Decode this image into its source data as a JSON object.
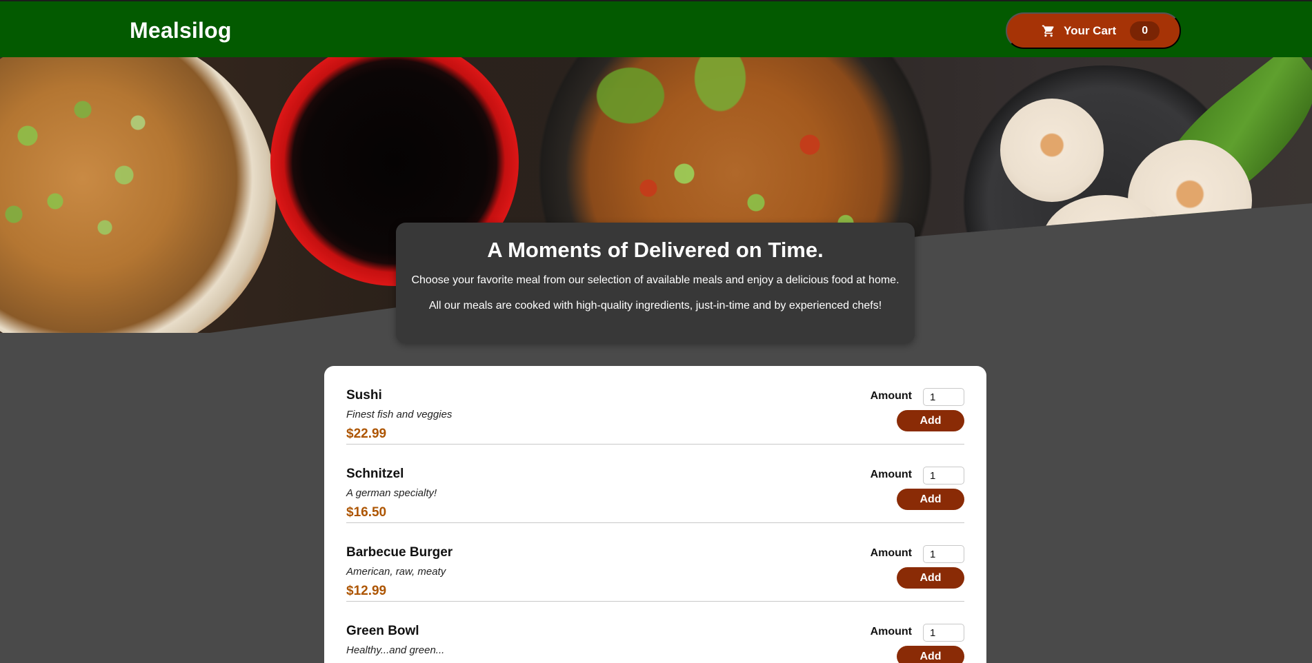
{
  "header": {
    "logo": "Mealsilog",
    "cart": {
      "label": "Your Cart",
      "count": "0",
      "icon": "shopping-cart-icon"
    }
  },
  "summary": {
    "title": "A Moments of Delivered on Time.",
    "paragraphs": [
      "Choose your favorite meal from our selection of available meals and enjoy a delicious food at home.",
      "All our meals are cooked with high-quality ingredients, just-in-time and by experienced chefs!"
    ]
  },
  "meals": [
    {
      "name": "Sushi",
      "description": "Finest fish and veggies",
      "price": "$22.99",
      "amount_label": "Amount",
      "amount": "1",
      "add_label": "Add"
    },
    {
      "name": "Schnitzel",
      "description": "A german specialty!",
      "price": "$16.50",
      "amount_label": "Amount",
      "amount": "1",
      "add_label": "Add"
    },
    {
      "name": "Barbecue Burger",
      "description": "American, raw, meaty",
      "price": "$12.99",
      "amount_label": "Amount",
      "amount": "1",
      "add_label": "Add"
    },
    {
      "name": "Green Bowl",
      "description": "Healthy...and green...",
      "price": "",
      "amount_label": "Amount",
      "amount": "1",
      "add_label": "Add"
    }
  ],
  "colors": {
    "header_bg": "#035a00",
    "cart_button": "#a63306",
    "add_button": "#8a2b06",
    "price": "#ad5502",
    "page_bg": "#4a4a4a"
  }
}
